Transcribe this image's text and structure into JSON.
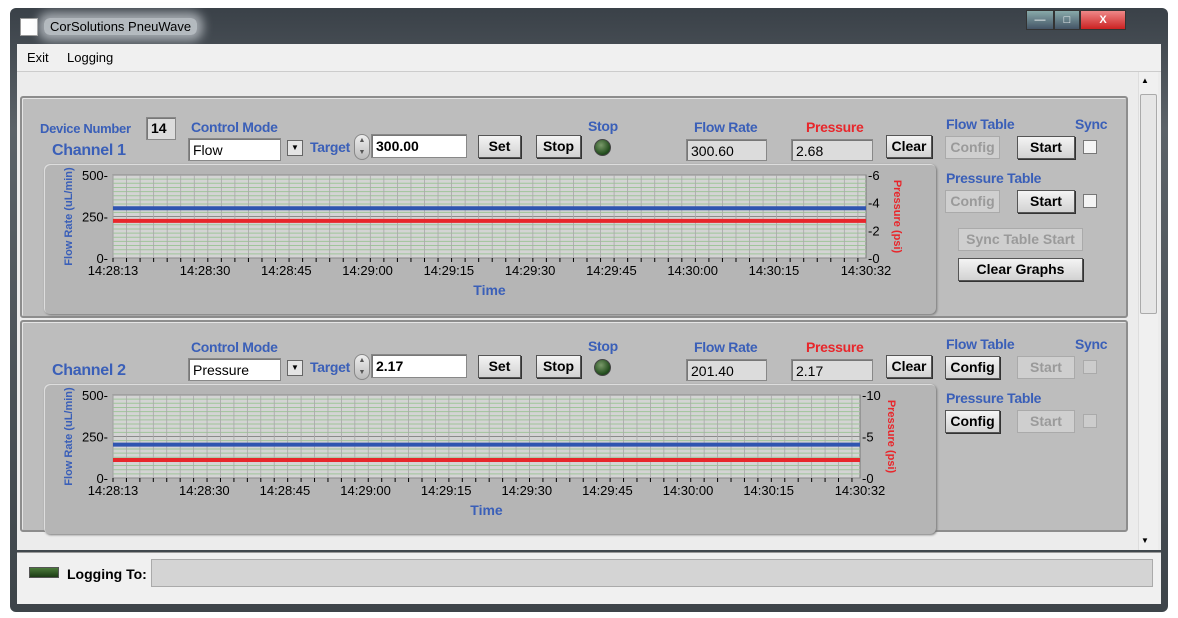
{
  "window": {
    "title": "CorSolutions PneuWave",
    "minimize": "—",
    "maximize": "□",
    "close": "X"
  },
  "menu": [
    "Exit",
    "Logging"
  ],
  "channels": [
    {
      "device_number_label": "Device Number",
      "device_number": "14",
      "name": "Channel 1",
      "control_mode_label": "Control Mode",
      "control_mode": "Flow",
      "target_label": "Target",
      "target": "300.00",
      "set": "Set",
      "stop": "Stop",
      "stop_indicator_label": "Stop",
      "flow_rate_label": "Flow Rate",
      "flow_rate": "300.60",
      "pressure_label": "Pressure",
      "pressure": "2.68",
      "clear": "Clear",
      "flow_table": {
        "label": "Flow Table",
        "config": "Config",
        "config_enabled": false,
        "start": "Start",
        "start_enabled": true,
        "sync_enabled": true
      },
      "sync_label": "Sync",
      "pressure_table": {
        "label": "Pressure Table",
        "config": "Config",
        "config_enabled": false,
        "start": "Start",
        "start_enabled": true,
        "sync_enabled": true
      },
      "sync_table_start": "Sync Table Start",
      "clear_graphs": "Clear Graphs"
    },
    {
      "name": "Channel 2",
      "control_mode_label": "Control Mode",
      "control_mode": "Pressure",
      "target_label": "Target",
      "target": "2.17",
      "set": "Set",
      "stop": "Stop",
      "stop_indicator_label": "Stop",
      "flow_rate_label": "Flow Rate",
      "flow_rate": "201.40",
      "pressure_label": "Pressure",
      "pressure": "2.17",
      "clear": "Clear",
      "flow_table": {
        "label": "Flow Table",
        "config": "Config",
        "config_enabled": true,
        "start": "Start",
        "start_enabled": false,
        "sync_enabled": false
      },
      "sync_label": "Sync",
      "pressure_table": {
        "label": "Pressure Table",
        "config": "Config",
        "config_enabled": true,
        "start": "Start",
        "start_enabled": false,
        "sync_enabled": false
      }
    }
  ],
  "status": {
    "logging_label": "Logging To:",
    "logging_path": ""
  },
  "chart_data": [
    {
      "type": "line",
      "xlabel": "Time",
      "ylabel": "Flow Rate (uL/min)",
      "y2label": "Pressure (psi)",
      "xlim": [
        "14:28:13",
        "14:30:32"
      ],
      "xticks": [
        "14:28:13",
        "14:28:30",
        "14:28:45",
        "14:29:00",
        "14:29:15",
        "14:29:30",
        "14:29:45",
        "14:30:00",
        "14:30:15",
        "14:30:32"
      ],
      "ylim": [
        0,
        500
      ],
      "yticks": [
        0,
        250,
        500
      ],
      "y2lim": [
        0,
        6
      ],
      "y2ticks": [
        0,
        2,
        4,
        6
      ],
      "grid": true,
      "series": [
        {
          "axis": "left",
          "color": "#2f55b0",
          "value": 300
        },
        {
          "axis": "right",
          "color": "#e8262b",
          "value": 2.68
        }
      ]
    },
    {
      "type": "line",
      "xlabel": "Time",
      "ylabel": "Flow Rate (uL/min)",
      "y2label": "Pressure (psi)",
      "xlim": [
        "14:28:13",
        "14:30:32"
      ],
      "xticks": [
        "14:28:13",
        "14:28:30",
        "14:28:45",
        "14:29:00",
        "14:29:15",
        "14:29:30",
        "14:29:45",
        "14:30:00",
        "14:30:15",
        "14:30:32"
      ],
      "ylim": [
        0,
        500
      ],
      "yticks": [
        0,
        250,
        500
      ],
      "y2lim": [
        0,
        10
      ],
      "y2ticks": [
        0,
        5,
        10
      ],
      "grid": true,
      "series": [
        {
          "axis": "left",
          "color": "#2f55b0",
          "value": 201.4
        },
        {
          "axis": "right",
          "color": "#e8262b",
          "value": 2.17
        }
      ]
    }
  ]
}
